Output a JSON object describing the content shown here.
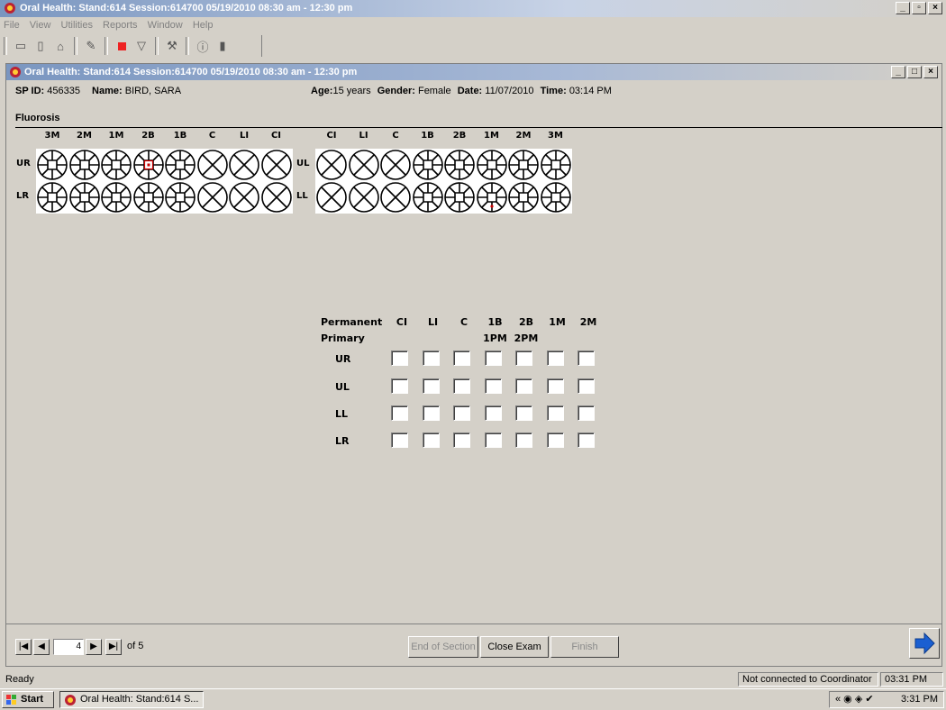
{
  "window": {
    "title": "Oral Health: Stand:614 Session:614700 05/19/2010 08:30 am - 12:30 pm",
    "child_title": "Oral Health: Stand:614 Session:614700 05/19/2010 08:30 am - 12:30 pm"
  },
  "menu": [
    "File",
    "View",
    "Utilities",
    "Reports",
    "Window",
    "Help"
  ],
  "patient": {
    "sp_id_label": "SP ID:",
    "sp_id": "456335",
    "name_label": "Name:",
    "name": "BIRD, SARA",
    "age_label": "Age:",
    "age": "15 years",
    "gender_label": "Gender:",
    "gender": "Female",
    "date_label": "Date:",
    "date": "11/07/2010",
    "time_label": "Time:",
    "time": "03:14 PM"
  },
  "section_title": "Fluorosis",
  "chart": {
    "right_columns": [
      "3M",
      "2M",
      "1M",
      "2B",
      "1B",
      "C",
      "LI",
      "CI"
    ],
    "left_columns": [
      "CI",
      "LI",
      "C",
      "1B",
      "2B",
      "1M",
      "2M",
      "3M"
    ],
    "rows": [
      {
        "left_label": "UR",
        "right_label": "UL",
        "right_teeth": [
          "molar",
          "molar",
          "molar",
          "molar-marked",
          "molar",
          "incisor",
          "incisor",
          "incisor"
        ],
        "left_teeth": [
          "incisor",
          "incisor",
          "incisor",
          "molar",
          "molar",
          "molar",
          "molar",
          "molar"
        ]
      },
      {
        "left_label": "LR",
        "right_label": "LL",
        "right_teeth": [
          "molar",
          "molar",
          "molar",
          "molar",
          "molar",
          "incisor",
          "incisor",
          "incisor"
        ],
        "left_teeth": [
          "incisor",
          "incisor",
          "incisor",
          "molar",
          "molar",
          "molar-dot",
          "molar",
          "molar"
        ]
      }
    ]
  },
  "grid": {
    "permanent_label": "Permanent",
    "primary_label": "Primary",
    "columns": [
      "CI",
      "LI",
      "C",
      "1B",
      "2B",
      "1M",
      "2M"
    ],
    "primary_columns": [
      "",
      "",
      "",
      "1PM",
      "2PM",
      "",
      ""
    ],
    "rows": [
      "UR",
      "UL",
      "LL",
      "LR"
    ]
  },
  "nav": {
    "page": "4",
    "of_text": "of 5",
    "end_of_section": "End of Section",
    "close_exam": "Close Exam",
    "finish": "Finish"
  },
  "status": {
    "ready": "Ready",
    "coordinator": "Not connected to Coordinator",
    "time": "03:31 PM"
  },
  "taskbar": {
    "start": "Start",
    "task": "Oral Health: Stand:614 S...",
    "clock": "3:31 PM"
  },
  "colors": {
    "accent": "#7a96c0",
    "mark": "#cc0000",
    "arrow": "#1a5fd1"
  }
}
